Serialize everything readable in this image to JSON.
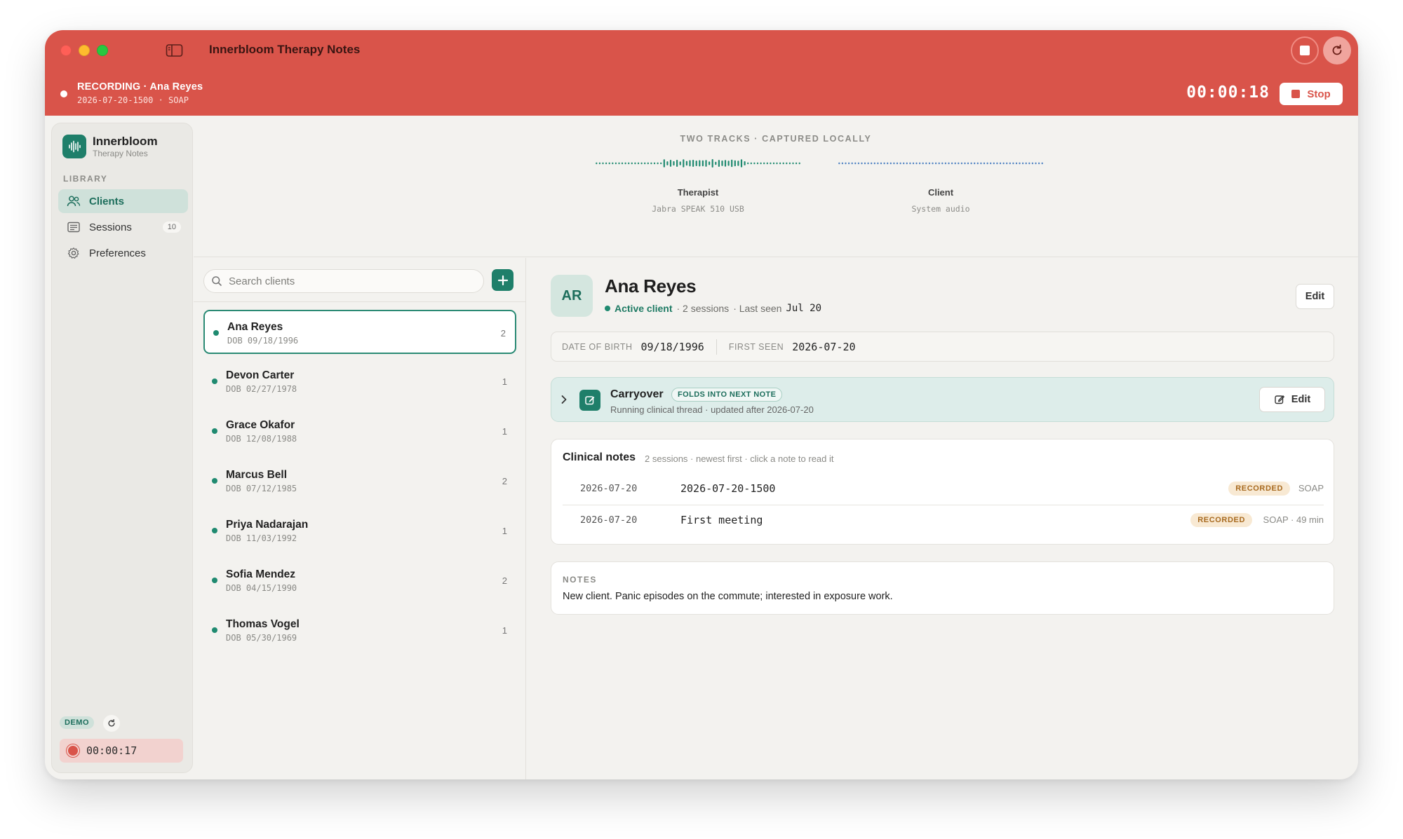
{
  "window": {
    "title": "Innerbloom Therapy Notes"
  },
  "recording": {
    "status": "RECORDING · Ana Reyes",
    "meta": "2026-07-20-1500 · SOAP",
    "timer": "00:00:18",
    "stop_label": "Stop"
  },
  "sidebar": {
    "brand": "Innerbloom",
    "brand_sub": "Therapy Notes",
    "section_label": "LIBRARY",
    "items": [
      {
        "label": "Clients",
        "icon": "people-icon",
        "active": true
      },
      {
        "label": "Sessions",
        "icon": "list-icon",
        "badge": "10"
      },
      {
        "label": "Preferences",
        "icon": "gear-icon"
      }
    ],
    "demo_badge": "DEMO",
    "mini_timer": "00:00:17"
  },
  "tracks": {
    "title": "TWO TRACKS · CAPTURED LOCALLY",
    "items": [
      {
        "name": "Therapist",
        "device": "Jabra SPEAK 510 USB",
        "color": "#1f8a70"
      },
      {
        "name": "Client",
        "device": "System audio",
        "color": "#4a7fc1"
      }
    ]
  },
  "client_list": {
    "search_placeholder": "Search clients",
    "clients": [
      {
        "name": "Ana Reyes",
        "dob": "DOB 09/18/1996",
        "count": "2",
        "selected": true
      },
      {
        "name": "Devon Carter",
        "dob": "DOB 02/27/1978",
        "count": "1"
      },
      {
        "name": "Grace Okafor",
        "dob": "DOB 12/08/1988",
        "count": "1"
      },
      {
        "name": "Marcus Bell",
        "dob": "DOB 07/12/1985",
        "count": "2"
      },
      {
        "name": "Priya Nadarajan",
        "dob": "DOB 11/03/1992",
        "count": "1"
      },
      {
        "name": "Sofia Mendez",
        "dob": "DOB 04/15/1990",
        "count": "2"
      },
      {
        "name": "Thomas Vogel",
        "dob": "DOB 05/30/1969",
        "count": "1"
      }
    ]
  },
  "detail": {
    "initials": "AR",
    "name": "Ana Reyes",
    "status": "Active client",
    "sessions_text": "· 2 sessions",
    "last_seen_label": "· Last seen",
    "last_seen_value": "Jul 20",
    "edit_label": "Edit",
    "dob_label": "DATE OF BIRTH",
    "dob_value": "09/18/1996",
    "first_seen_label": "FIRST SEEN",
    "first_seen_value": "2026-07-20",
    "carryover": {
      "title": "Carryover",
      "badge": "FOLDS INTO NEXT NOTE",
      "subtitle": "Running clinical thread · updated after 2026-07-20",
      "edit_label": "Edit"
    },
    "clinical_notes": {
      "title": "Clinical notes",
      "subtitle": "2 sessions · newest first · click a note to read it",
      "rows": [
        {
          "date": "2026-07-20",
          "title": "2026-07-20-1500",
          "badge": "RECORDED",
          "format": "SOAP"
        },
        {
          "date": "2026-07-20",
          "title": "First meeting",
          "badge": "RECORDED",
          "format": "SOAP · 49 min"
        }
      ]
    },
    "notes": {
      "label": "NOTES",
      "text": "New client. Panic episodes on the commute; interested in exposure work."
    }
  }
}
